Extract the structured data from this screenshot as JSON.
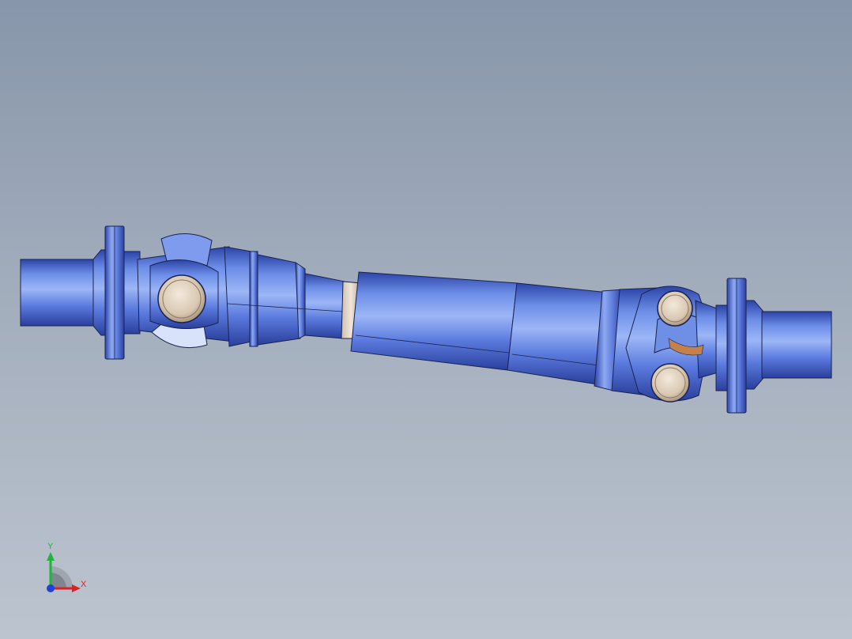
{
  "viewport": {
    "background_top": "#8796aa",
    "background_bottom": "#bcc4cf"
  },
  "model": {
    "part_color": "#5c7ee0",
    "bearing_cap_color": "#e6d8c6",
    "icon": "drive-shaft-assembly"
  },
  "triad": {
    "x_label": "X",
    "y_label": "Y",
    "x_color": "#e02020",
    "y_color": "#1fb53a",
    "z_color": "#2040d8"
  }
}
